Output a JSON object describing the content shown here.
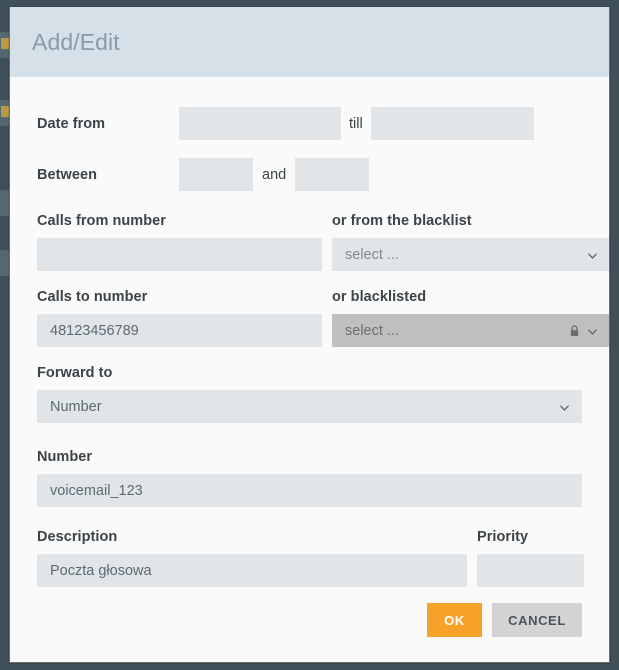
{
  "window": {
    "chrome_color": "#3f5058",
    "modal_border": "#6d6d6d"
  },
  "modal": {
    "title": "Add/Edit",
    "header_color": "#d5e0e8",
    "title_color": "#8b9ba6",
    "body_color": "#fafafa"
  },
  "form": {
    "date_from": {
      "label": "Date from",
      "from_value": "",
      "from_placeholder": "",
      "separator_label": "till",
      "till_value": "",
      "till_placeholder": ""
    },
    "between": {
      "label": "Between",
      "from_value": "",
      "from_placeholder": "",
      "separator_label": "and",
      "to_value": "",
      "to_placeholder": ""
    },
    "calls_from_number": {
      "label": "Calls from number",
      "value": "",
      "placeholder": ""
    },
    "from_blacklist": {
      "label": "or from the blacklist",
      "selected": "select ...",
      "disabled": false,
      "caret_icon": "chevron-down-icon"
    },
    "calls_to_number": {
      "label": "Calls to number",
      "value": "48123456789",
      "placeholder": ""
    },
    "or_blacklisted": {
      "label": "or blacklisted",
      "selected": "select ...",
      "disabled": true,
      "lock_icon": "lock-icon",
      "caret_icon": "chevron-down-icon",
      "disabled_bg": "#bfbfbf"
    },
    "forward_to": {
      "label": "Forward to",
      "selected": "Number",
      "caret_icon": "chevron-down-icon"
    },
    "number": {
      "label": "Number",
      "value": "voicemail_123",
      "placeholder": ""
    },
    "description": {
      "label": "Description",
      "value": "Poczta głosowa",
      "placeholder": ""
    },
    "priority": {
      "label": "Priority",
      "value": "",
      "placeholder": ""
    }
  },
  "footer": {
    "ok_label": "OK",
    "ok_color": "#f7a32b",
    "cancel_label": "CANCEL",
    "cancel_color": "#d4d4d4"
  }
}
